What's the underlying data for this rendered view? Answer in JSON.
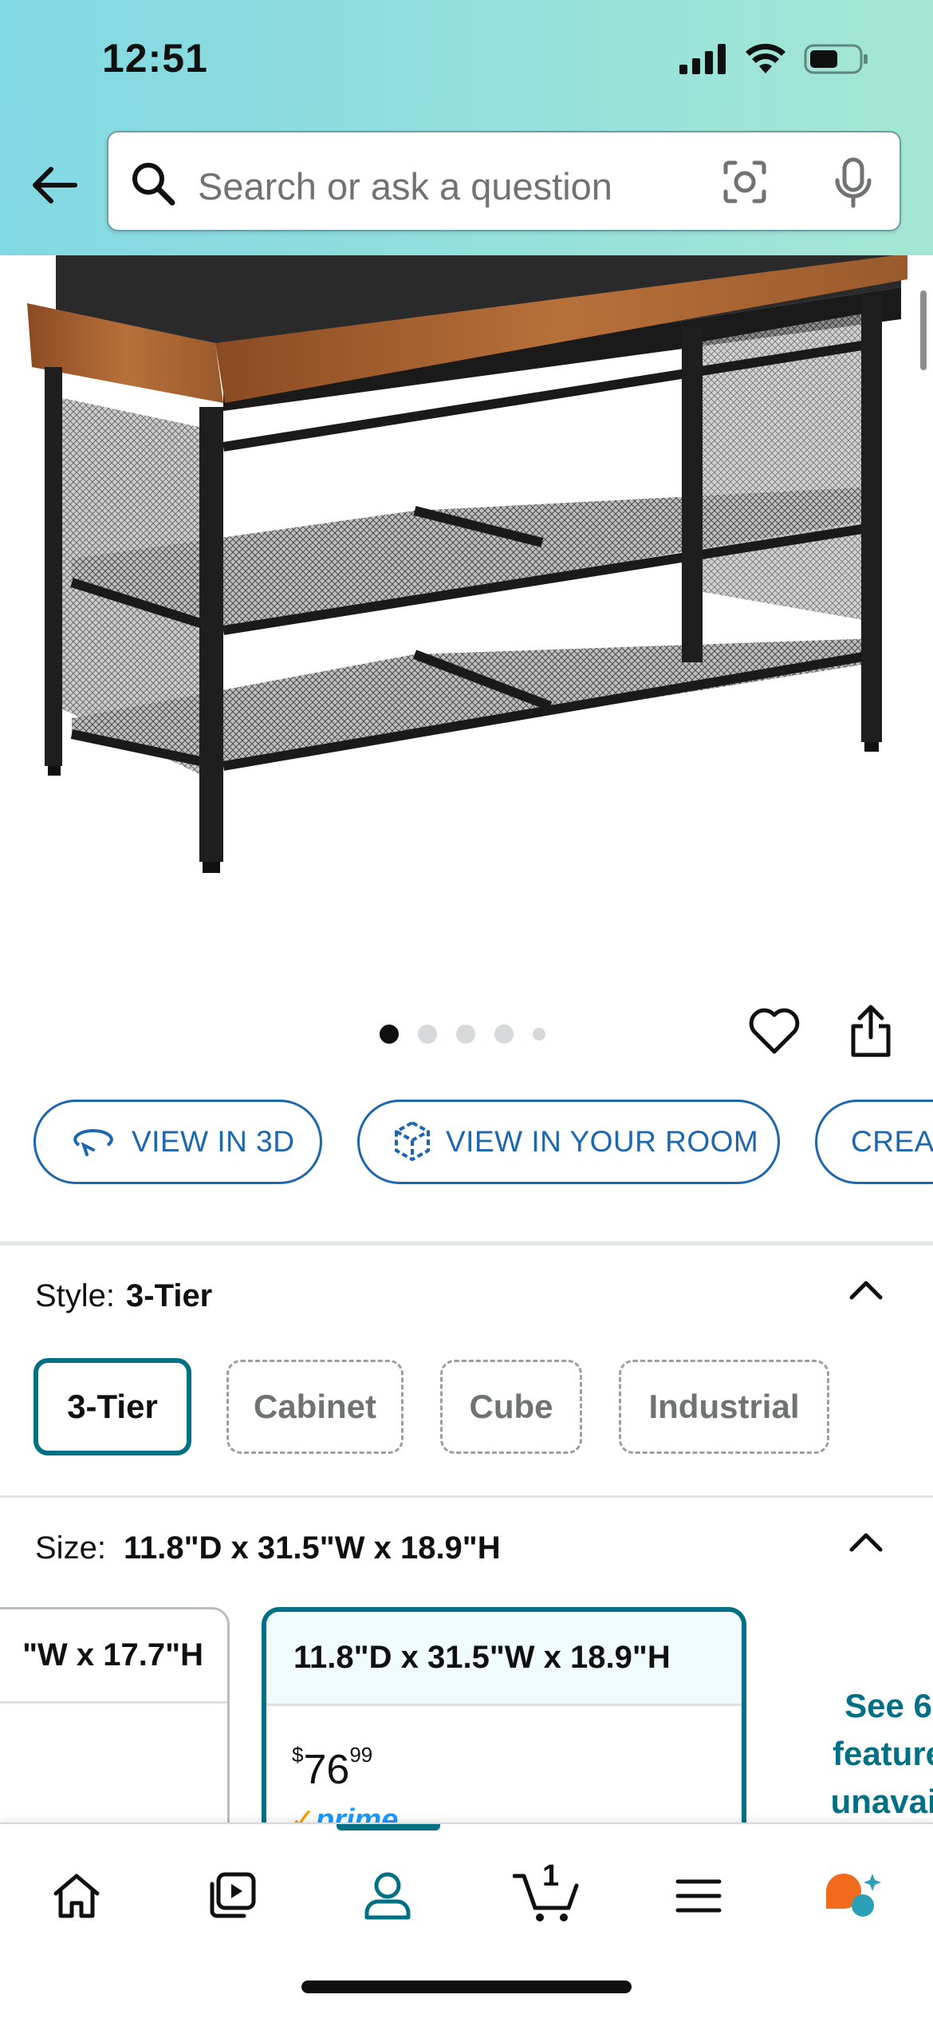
{
  "status_bar": {
    "time": "12:51"
  },
  "search": {
    "placeholder": "Search or ask a question"
  },
  "product_images": {
    "count": 5,
    "active_index": 0
  },
  "view_buttons": [
    {
      "label": "VIEW IN 3D"
    },
    {
      "label": "VIEW IN YOUR ROOM"
    },
    {
      "label": "CREAT"
    }
  ],
  "style": {
    "label": "Style:",
    "selected": "3-Tier",
    "options": [
      "3-Tier",
      "Cabinet",
      "Cube",
      "Industrial"
    ]
  },
  "size": {
    "label": "Size:",
    "selected": "11.8\"D x 31.5\"W x 18.9\"H",
    "cards": [
      {
        "title": "\"W x 17.7\"H"
      },
      {
        "title": "11.8\"D x 31.5\"W x 18.9\"H",
        "price_symbol": "$",
        "price_whole": "76",
        "price_fraction": "99",
        "prime_check": "✓",
        "prime_label": "prime"
      }
    ],
    "see_more_lines": [
      "See 6",
      "feature",
      "unavail"
    ]
  },
  "tabbar": {
    "items": [
      "home",
      "video",
      "account",
      "cart",
      "menu",
      "rufus"
    ],
    "active": "account",
    "cart_count": "1"
  },
  "colors": {
    "accent_teal": "#007185",
    "link_blue": "#1d66b0",
    "prime_blue": "#1a98ff",
    "prime_orange": "#ff9900",
    "header_gradient_start": "#82d8e3",
    "header_gradient_end": "#a5e7d3"
  }
}
